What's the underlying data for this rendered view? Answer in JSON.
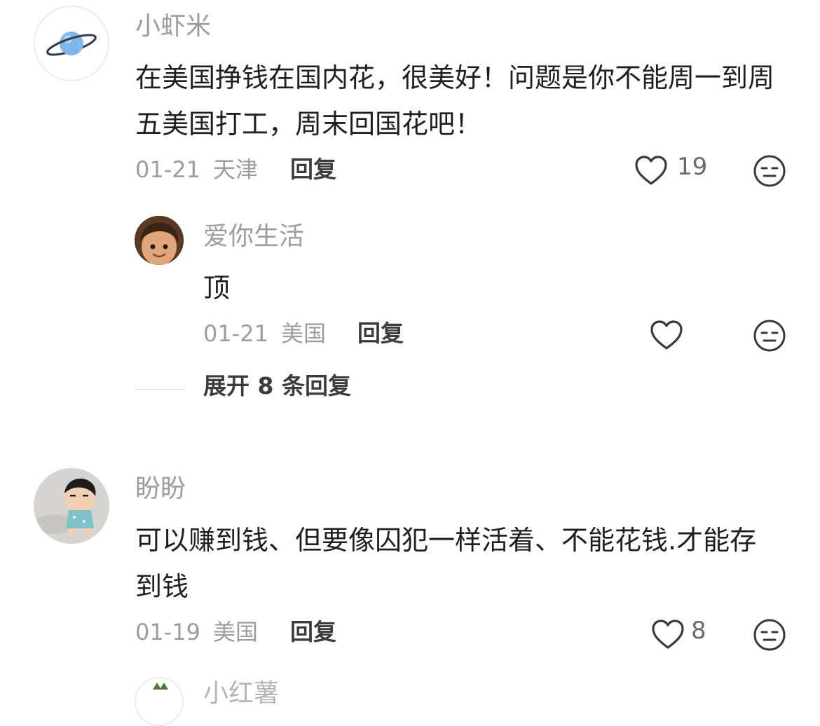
{
  "comments": [
    {
      "username": "小虾米",
      "text": "在美国挣钱在国内花，很美好！问题是你不能周一到周五美国打工，周末回国花吧！",
      "date": "01-21",
      "location": "天津",
      "reply_label": "回复",
      "likes": "19",
      "replies": [
        {
          "username": "爱你生活",
          "text": "顶",
          "date": "01-21",
          "location": "美国",
          "reply_label": "回复",
          "likes": ""
        }
      ],
      "expand_label": "展开 8 条回复"
    },
    {
      "username": "盼盼",
      "text": "可以赚到钱、但要像囚犯一样活着、不能花钱.才能存到钱",
      "date": "01-19",
      "location": "美国",
      "reply_label": "回复",
      "likes": "8"
    }
  ],
  "partial_next_username": "小红薯",
  "icons": {
    "like": "heart-outline-icon",
    "dislike": "neutral-face-icon"
  },
  "colors": {
    "username": "#9d9d9d",
    "text": "#1f1f1f",
    "meta": "#9d9d9d",
    "action": "#3c3c3c"
  }
}
